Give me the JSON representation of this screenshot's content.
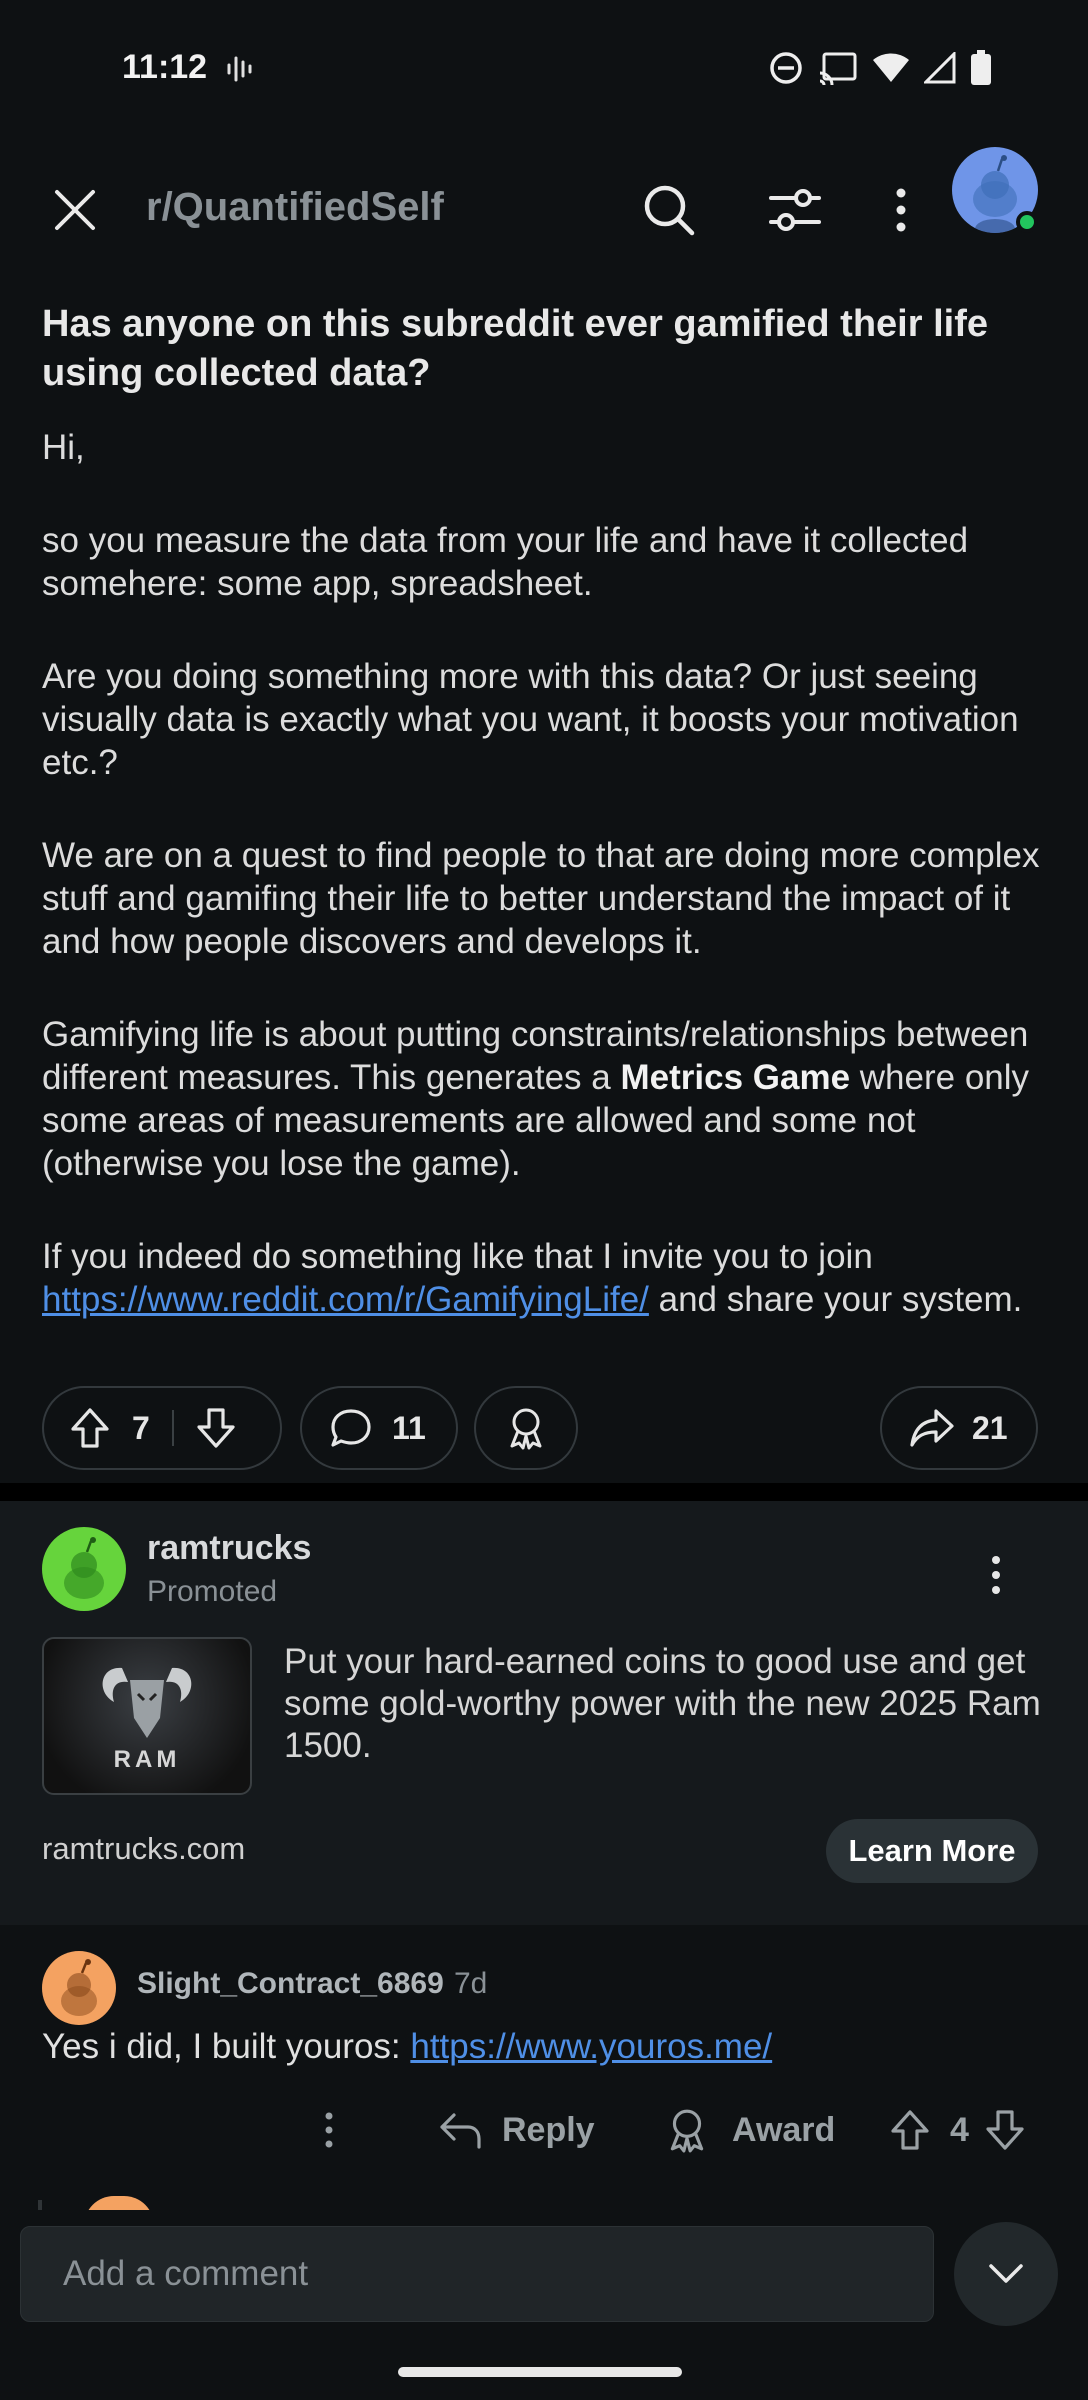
{
  "status_bar": {
    "time": "11:12"
  },
  "header": {
    "subreddit": "r/QuantifiedSelf"
  },
  "post": {
    "title": "Has anyone on this subreddit ever gamified their life using collected data?",
    "body": {
      "p1": "Hi,",
      "p2": "so you measure the data from your life and have it collected somehere: some app, spreadsheet.",
      "p3": "Are you doing something more with this data? Or just seeing visually data is exactly what you want, it boosts your motivation etc.?",
      "p4": "We are on a quest to find people to that are doing more complex stuff and gamifing their life to better understand the impact of it and how people discovers and develops it.",
      "p5_a": "Gamifying life is about putting constraints/relationships between different measures. This generates a ",
      "p5_bold": "Metrics Game",
      "p5_b": " where only some areas of measurements are allowed and some not (otherwise you lose the game).",
      "p6_a": "If you indeed do something like that I invite you to join ",
      "p6_link": "https://www.reddit.com/r/GamifyingLife/",
      "p6_b": " and share your system."
    },
    "votes": "7",
    "comments": "11",
    "shares": "21"
  },
  "ad": {
    "advertiser": "ramtrucks",
    "label": "Promoted",
    "thumb_text": "RAM",
    "text": "Put your hard-earned coins to good use and get some gold-worthy power with the new 2025 Ram 1500.",
    "domain": "ramtrucks.com",
    "cta": "Learn More"
  },
  "comment": {
    "username": "Slight_Contract_6869",
    "age": "7d",
    "text_prefix": "Yes i did, I built youros: ",
    "link": "https://www.youros.me/",
    "reply_label": "Reply",
    "award_label": "Award",
    "votes": "4"
  },
  "composer": {
    "placeholder": "Add a comment"
  }
}
